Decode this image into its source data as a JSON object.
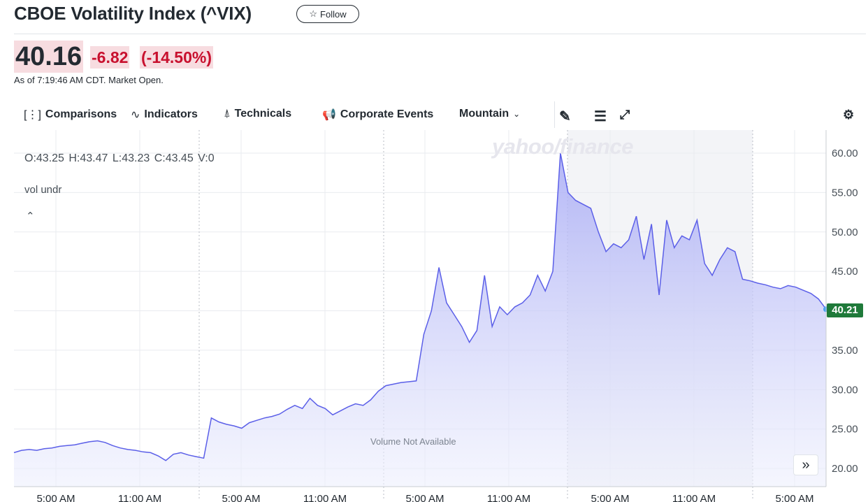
{
  "header": {
    "title": "CBOE Volatility Index (^VIX)",
    "follow_label": "Follow",
    "price": "40.16",
    "change": "-6.82",
    "change_pct": "(-14.50%)",
    "as_of": "As of 7:19:46 AM CDT. Market Open."
  },
  "toolbar": {
    "comparisons": "Comparisons",
    "indicators": "Indicators",
    "technicals": "Technicals",
    "corporate_events": "Corporate Events",
    "chart_type": "Mountain"
  },
  "chart_overlay": {
    "ohlc": "O:43.25  H:43.47  L:43.23  C:43.45  V:0",
    "vol_label": "vol undr",
    "watermark": "yahoo/finance",
    "volume_note": "Volume Not Available",
    "last_price_badge": "40.21"
  },
  "colors": {
    "line": "#5b5fe8",
    "negative": "#c8102e",
    "badge": "#1f7a3a"
  },
  "chart_data": {
    "type": "area",
    "y_ticks": [
      "60.00",
      "55.00",
      "50.00",
      "45.00",
      "40.00",
      "35.00",
      "30.00",
      "25.00",
      "20.00"
    ],
    "ylim": [
      17.5,
      62.5
    ],
    "x_ticks": [
      "5:00 AM",
      "11:00 AM",
      "5:00 AM",
      "11:00 AM",
      "5:00 AM",
      "11:00 AM",
      "5:00 AM",
      "11:00 AM",
      "5:00 AM"
    ],
    "series": [
      {
        "values": [
          22.0,
          22.3,
          22.4,
          22.3,
          22.5,
          22.6,
          22.8,
          22.9,
          23.0,
          23.2,
          23.4,
          23.5,
          23.3,
          22.9,
          22.6,
          22.4,
          22.3,
          22.1,
          22.0,
          21.6,
          21.0,
          21.8,
          22.0,
          21.7,
          21.5,
          21.3,
          26.4,
          25.9,
          25.6,
          25.4,
          25.1,
          25.8,
          26.1,
          26.4,
          26.6,
          26.9,
          27.5,
          28.0,
          27.6,
          28.9,
          28.0,
          27.6,
          26.8,
          27.3,
          27.8,
          28.2,
          28.0,
          28.7,
          29.8,
          30.5,
          30.7,
          30.9,
          31.0,
          31.1,
          37.0,
          40.0,
          45.5,
          41.0,
          39.5,
          38.0,
          36.0,
          37.5,
          44.5,
          38.0,
          40.5,
          39.5,
          40.5,
          41.0,
          42.0,
          44.5,
          42.5,
          45.0,
          60.0,
          55.0,
          54.0,
          53.5,
          53.0,
          50.0,
          47.5,
          48.5,
          48.0,
          49.0,
          52.0,
          46.5,
          51.0,
          42.0,
          51.5,
          48.0,
          49.5,
          49.0,
          51.5,
          46.0,
          44.5,
          46.5,
          48.0,
          47.5,
          44.0,
          43.8,
          43.5,
          43.3,
          43.0,
          42.8,
          43.2,
          43.0,
          42.6,
          42.2,
          41.5,
          40.2
        ]
      }
    ]
  }
}
